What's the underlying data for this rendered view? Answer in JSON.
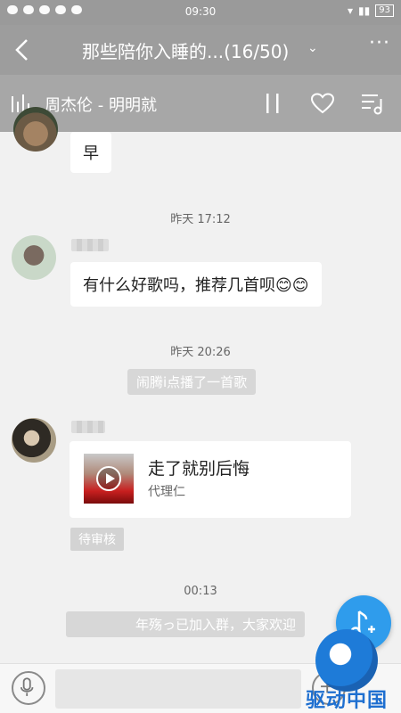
{
  "status_bar": {
    "time": "09:30",
    "battery": "93"
  },
  "header": {
    "title": "那些陪你入睡的...(16/50)"
  },
  "music_bar": {
    "now_playing": "周杰伦 - 明明就"
  },
  "messages": {
    "m1_text": "早",
    "ts1": "昨天 17:12",
    "m2_text": "有什么好歌吗，推荐几首呗😊😊",
    "ts2": "昨天 20:26",
    "sys1": "闹腾i点播了一首歌",
    "song_card": {
      "title": "走了就别后悔",
      "artist": "代理仁"
    },
    "pending": "待审核",
    "ts3": "00:13",
    "sys2": "年殇っ已加入群，大家欢迎"
  },
  "watermark": {
    "text": "驱动中国"
  },
  "colors": {
    "header_bg": "#9d9d9d",
    "accent": "#2f9cec",
    "bubble": "#ffffff",
    "page_bg": "#f1f1f1"
  }
}
